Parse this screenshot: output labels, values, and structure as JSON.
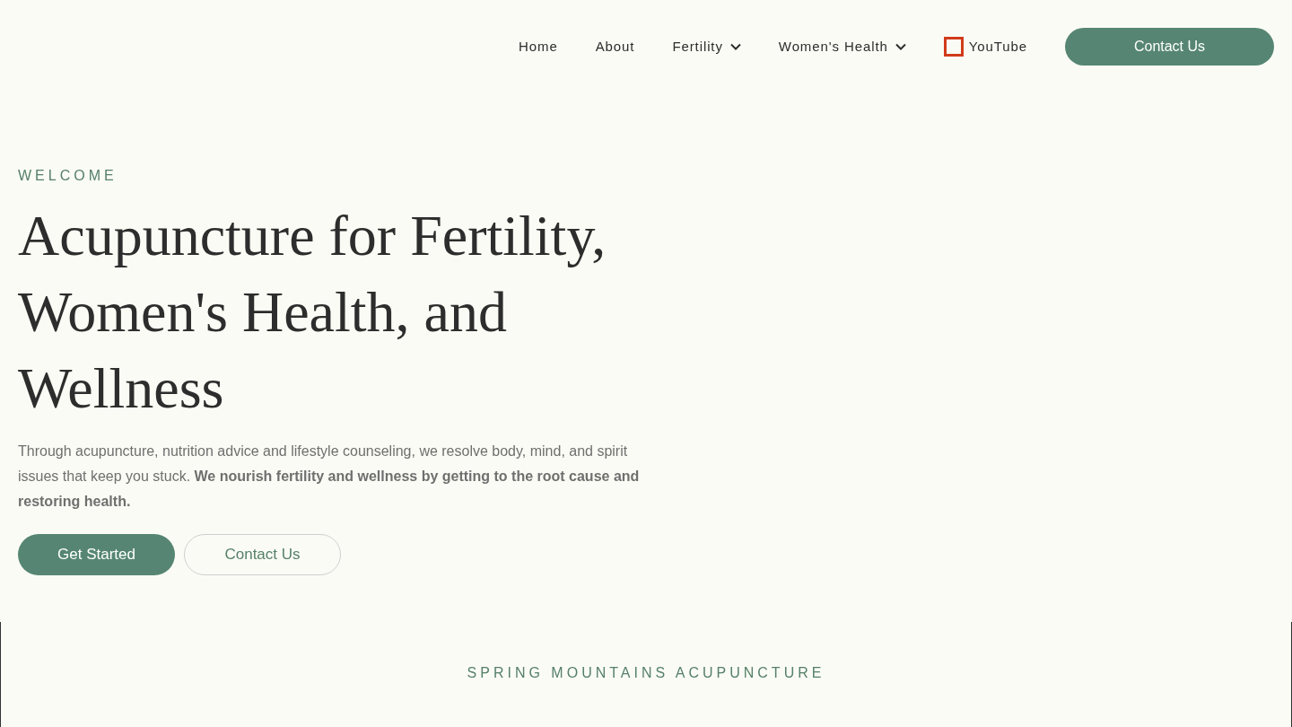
{
  "nav": {
    "items": [
      {
        "label": "Home",
        "kind": "link"
      },
      {
        "label": "About",
        "kind": "link"
      },
      {
        "label": "Fertility",
        "kind": "dropdown"
      },
      {
        "label": "Women's Health",
        "kind": "dropdown"
      },
      {
        "label": "YouTube",
        "kind": "icon-link"
      }
    ],
    "cta": "Contact Us"
  },
  "hero": {
    "eyebrow": "WELCOME",
    "title": "Acupuncture for Fertility, Women's Health, and Wellness",
    "text": "Through acupuncture, nutrition advice and lifestyle counseling, we resolve body, mind, and spirit issues that keep you stuck. **We nourish fertility and wellness by getting to the root cause and restoring health.**",
    "buttons": [
      {
        "label": "Get Started",
        "kind": "primary"
      },
      {
        "label": "Contact Us",
        "kind": "outline"
      }
    ]
  },
  "section": {
    "eyebrow": "SPRING MOUNTAINS ACUPUNCTURE"
  }
}
